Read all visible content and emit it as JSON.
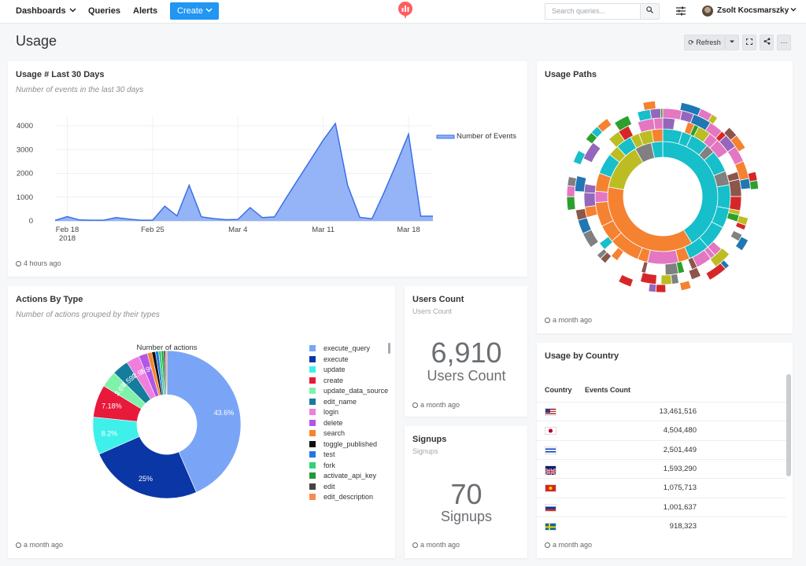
{
  "nav": {
    "dashboards": "Dashboards",
    "queries": "Queries",
    "alerts": "Alerts",
    "create": "Create",
    "search_placeholder": "Search queries...",
    "user_name": "Zsolt Kocsmarszky"
  },
  "page": {
    "title": "Usage",
    "refresh_label": "Refresh"
  },
  "colors": {
    "accent": "#2196f3",
    "logo": "#ff5d5d",
    "area": "#8fb0f7",
    "line": "#3a70e8"
  },
  "widgets": {
    "events": {
      "title": "Usage # Last 30 Days",
      "description": "Number of events in the last 30 days",
      "footer": "4 hours ago",
      "legend": "Number of Events"
    },
    "paths": {
      "title": "Usage Paths",
      "footer": "a month ago"
    },
    "actions": {
      "title": "Actions By Type",
      "description": "Number of actions grouped by their types",
      "footer": "a month ago",
      "chart_title": "Number of actions"
    },
    "users": {
      "title": "Users Count",
      "subtitle": "Users Count",
      "value": "6,910",
      "label": "Users Count",
      "footer": "a month ago"
    },
    "signups": {
      "title": "Signups",
      "subtitle": "Signups",
      "value": "70",
      "label": "Signups",
      "footer": "a month ago"
    },
    "country": {
      "title": "Usage by Country",
      "col_country": "Country",
      "col_events": "Events Count",
      "footer": "a month ago",
      "rows": [
        {
          "country": "US",
          "value": "13,461,516"
        },
        {
          "country": "JP",
          "value": "4,504,480"
        },
        {
          "country": "IL",
          "value": "2,501,449"
        },
        {
          "country": "GB",
          "value": "1,593,290"
        },
        {
          "country": "VN",
          "value": "1,075,713"
        },
        {
          "country": "RU",
          "value": "1,001,637"
        },
        {
          "country": "SE",
          "value": "918,323"
        }
      ]
    }
  },
  "chart_data": [
    {
      "type": "area",
      "title": "",
      "xlabel": "",
      "ylabel": "",
      "x_ticks": [
        "Feb 18 2018",
        "Feb 25",
        "Mar 4",
        "Mar 11",
        "Mar 18"
      ],
      "y_ticks": [
        0,
        1000,
        2000,
        3000,
        4000
      ],
      "ylim": [
        0,
        4400
      ],
      "legend": "right",
      "series": [
        {
          "name": "Number of Events",
          "x": [
            "2018-02-17",
            "2018-02-18",
            "2018-02-19",
            "2018-02-20",
            "2018-02-21",
            "2018-02-22",
            "2018-02-23",
            "2018-02-24",
            "2018-02-25",
            "2018-02-26",
            "2018-02-27",
            "2018-02-28",
            "2018-03-01",
            "2018-03-02",
            "2018-03-03",
            "2018-03-04",
            "2018-03-05",
            "2018-03-06",
            "2018-03-07",
            "2018-03-08",
            "2018-03-09",
            "2018-03-10",
            "2018-03-11",
            "2018-03-12",
            "2018-03-13",
            "2018-03-14",
            "2018-03-15",
            "2018-03-16",
            "2018-03-17",
            "2018-03-18",
            "2018-03-19",
            "2018-03-20"
          ],
          "values": [
            20,
            180,
            40,
            30,
            30,
            140,
            80,
            30,
            30,
            620,
            210,
            1500,
            170,
            100,
            50,
            60,
            560,
            140,
            170,
            1000,
            1800,
            2600,
            3400,
            4100,
            1500,
            150,
            90,
            1200,
            2400,
            3650,
            200,
            200
          ]
        }
      ]
    },
    {
      "type": "pie",
      "title": "Number of actions",
      "labels": [
        "execute_query",
        "execute",
        "update",
        "create",
        "update_data_source",
        "edit_name",
        "login",
        "delete",
        "search",
        "toggle_published",
        "test",
        "fork",
        "activate_api_key",
        "edit",
        "edit_description"
      ],
      "colors": [
        "#7aa5f7",
        "#0b36a5",
        "#3ef0ea",
        "#e8193b",
        "#7ff2aa",
        "#147c9c",
        "#ef7fdc",
        "#b256e8",
        "#f4852e",
        "#111111",
        "#2575e6",
        "#30d374",
        "#1e9b3c",
        "#444444",
        "#f98a4e"
      ],
      "values": [
        43.6,
        25,
        8.2,
        7.18,
        3.6,
        3.59,
        2.9,
        1.9,
        1.0,
        0.8,
        0.7,
        0.6,
        0.5,
        0.4,
        0.3
      ],
      "data_labels": [
        "43.6%",
        "25%",
        "8.2%",
        "7.18%",
        "3.6%",
        "3.59%",
        "2.9%",
        "1.9%"
      ]
    }
  ]
}
